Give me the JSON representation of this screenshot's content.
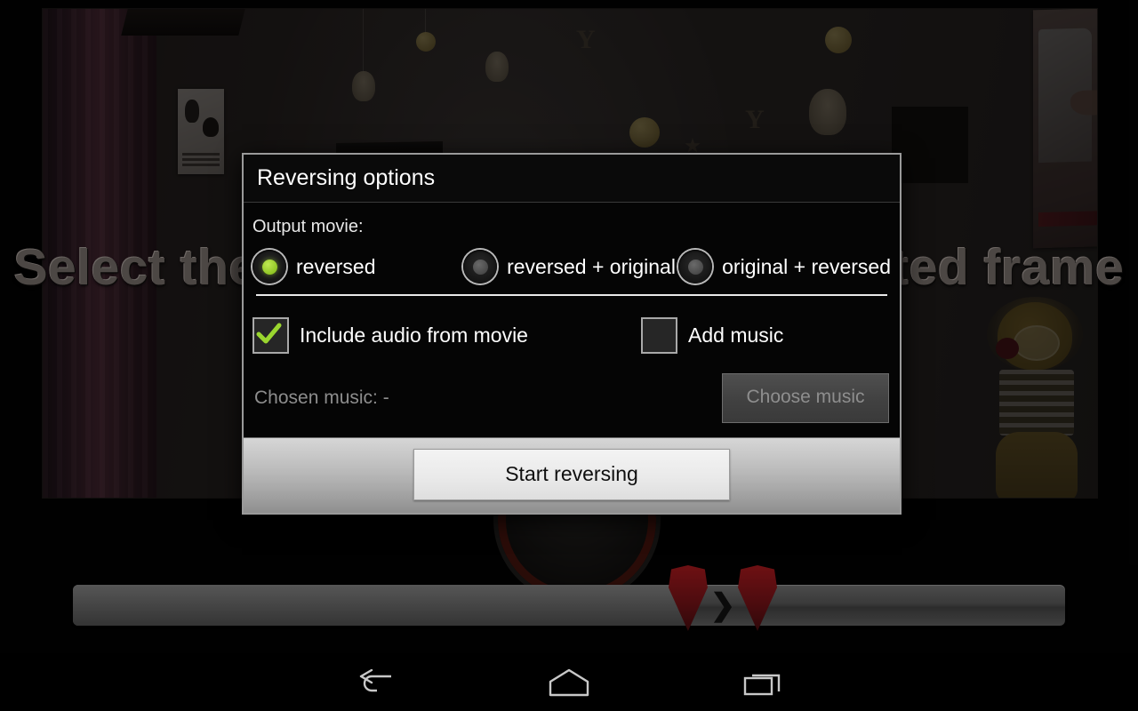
{
  "app": {
    "instruction_overlay": "Select the start and end of the reverted frame"
  },
  "dialog": {
    "title": "Reversing options",
    "output_label": "Output movie:",
    "output_options": [
      {
        "label": "reversed",
        "selected": true
      },
      {
        "label": "reversed + original",
        "selected": false
      },
      {
        "label": "original + reversed",
        "selected": false
      }
    ],
    "checkboxes": [
      {
        "label": "Include audio from movie",
        "checked": true
      },
      {
        "label": "Add music",
        "checked": false
      }
    ],
    "chosen_music_label": "Chosen music: -",
    "choose_music_button": "Choose music",
    "start_button": "Start reversing"
  },
  "trimbar": {
    "start_marker_percent": 62,
    "end_marker_percent": 69,
    "marker_glyph": "❯"
  },
  "navbar": {
    "back_label": "back-button",
    "home_label": "home-button",
    "recents_label": "recent-apps-button"
  },
  "colors": {
    "accent_green": "#9ad62f",
    "dialog_border": "#9a9a9a",
    "marker_red": "#4e0c0f",
    "footer_gray": "#bdbdbd"
  }
}
